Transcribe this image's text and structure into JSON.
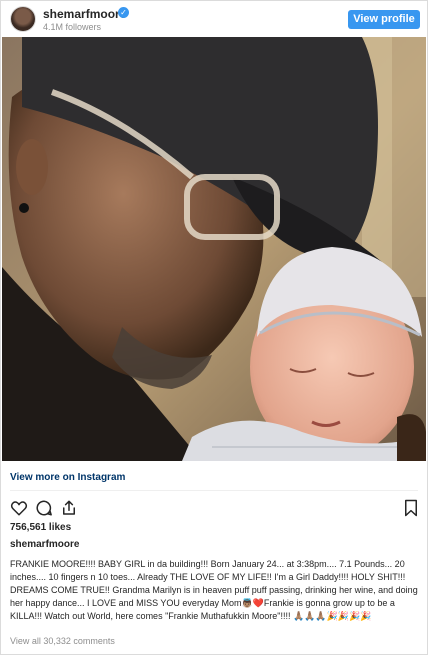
{
  "header": {
    "username": "shemarfmoore",
    "followers": "4.1M followers",
    "view_profile": "View profile"
  },
  "post": {
    "view_more": "View more on Instagram",
    "likes": "756,561 likes",
    "caption_user": "shemarfmoore",
    "caption": "FRANKIE MOORE!!!! BABY GIRL in da building!!! Born January 24... at 3:38pm.... 7.1 Pounds... 20 inches.... 10 fingers n 10 toes... Already THE LOVE OF MY LIFE!! I'm a Girl Daddy!!!! HOLY SHIT!!! DREAMS COME TRUE!! Grandma Marilyn is in heaven puff puff passing, drinking her wine, and doing her happy dance... I LOVE and MISS YOU everyday Mom👼🏽❤️Frankie is gonna grow up to be a KILLA!!! Watch out World, here comes \"Frankie Muthafukkin Moore\"!!!! 🙏🏽🙏🏽🙏🏽🎉🎉🎉🎉",
    "comments": "View all 30,332 comments"
  },
  "icons": [
    "verified-badge-icon",
    "heart-icon",
    "comment-icon",
    "share-icon",
    "bookmark-icon"
  ],
  "colors": {
    "accent": "#3897f0",
    "link": "#003569",
    "muted": "#8e8e8e",
    "text": "#262626"
  }
}
